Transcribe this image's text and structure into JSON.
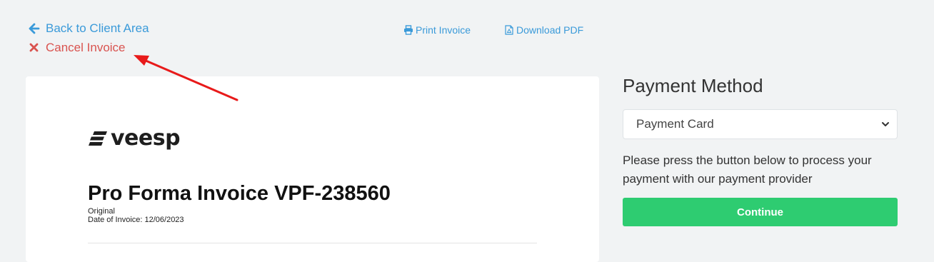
{
  "nav": {
    "back_label": "Back to Client Area",
    "cancel_label": "Cancel Invoice",
    "print_label": "Print Invoice",
    "download_label": "Download PDF"
  },
  "invoice": {
    "logo_text": "veesp",
    "title": "Pro Forma Invoice VPF-238560",
    "status": "Original",
    "date_line": "Date of Invoice: 12/06/2023"
  },
  "payment": {
    "heading": "Payment Method",
    "selected_method": "Payment Card",
    "note": "Please press the button below to process your payment with our payment provider",
    "continue_label": "Continue"
  },
  "colors": {
    "link_blue": "#3a9ad9",
    "cancel_red": "#d9534f",
    "continue_green": "#2ecc71",
    "annotation_arrow": "#e81a1a",
    "page_bg": "#f1f3f4"
  },
  "icons": {
    "back": "arrow-left-icon",
    "cancel": "times-icon",
    "print": "printer-icon",
    "pdf": "file-pdf-icon",
    "select": "chevron-down-icon"
  }
}
